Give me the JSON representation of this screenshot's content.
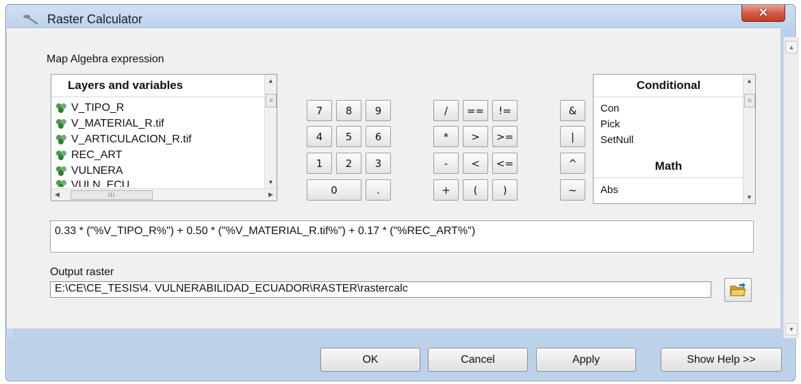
{
  "window": {
    "title": "Raster Calculator",
    "close_glyph": "✕"
  },
  "map_algebra_label": "Map Algebra expression",
  "layers": {
    "header": "Layers and variables",
    "items": [
      "V_TIPO_R",
      "V_MATERIAL_R.tif",
      "V_ARTICULACION_R.tif",
      "REC_ART",
      "VULNERA",
      "VULN_ECU"
    ],
    "hscroll_grip": "III"
  },
  "calculator": {
    "row1": [
      "7",
      "8",
      "9",
      "/",
      "==",
      "!=",
      "&"
    ],
    "row2": [
      "4",
      "5",
      "6",
      "*",
      ">",
      ">=",
      "|"
    ],
    "row3": [
      "1",
      "2",
      "3",
      "-",
      "<",
      "<=",
      "^"
    ],
    "row4": [
      "0",
      ".",
      "+",
      "(",
      ")",
      "~"
    ]
  },
  "functions": {
    "header_conditional": "Conditional",
    "conditional": [
      "Con",
      "Pick",
      "SetNull"
    ],
    "header_math": "Math",
    "math": [
      "Abs"
    ]
  },
  "expression": "0.33 * (\"%V_TIPO_R%\") + 0.50 * (\"%V_MATERIAL_R.tif%\") + 0.17 * (\"%REC_ART%\")",
  "output": {
    "label": "Output raster",
    "value": "E:\\CE\\CE_TESIS\\4. VULNERABILIDAD_ECUADOR\\RASTER\\rastercalc"
  },
  "buttons": {
    "ok": "OK",
    "cancel": "Cancel",
    "apply": "Apply",
    "help": "Show Help >>"
  },
  "icons": {
    "app": "raster-calculator-icon",
    "layer": "raster-layer-icon",
    "browse": "open-folder-icon"
  },
  "colors": {
    "close": "#c94a31",
    "layer_icon": "#3a8a3a",
    "folder": "#e8b93a"
  }
}
